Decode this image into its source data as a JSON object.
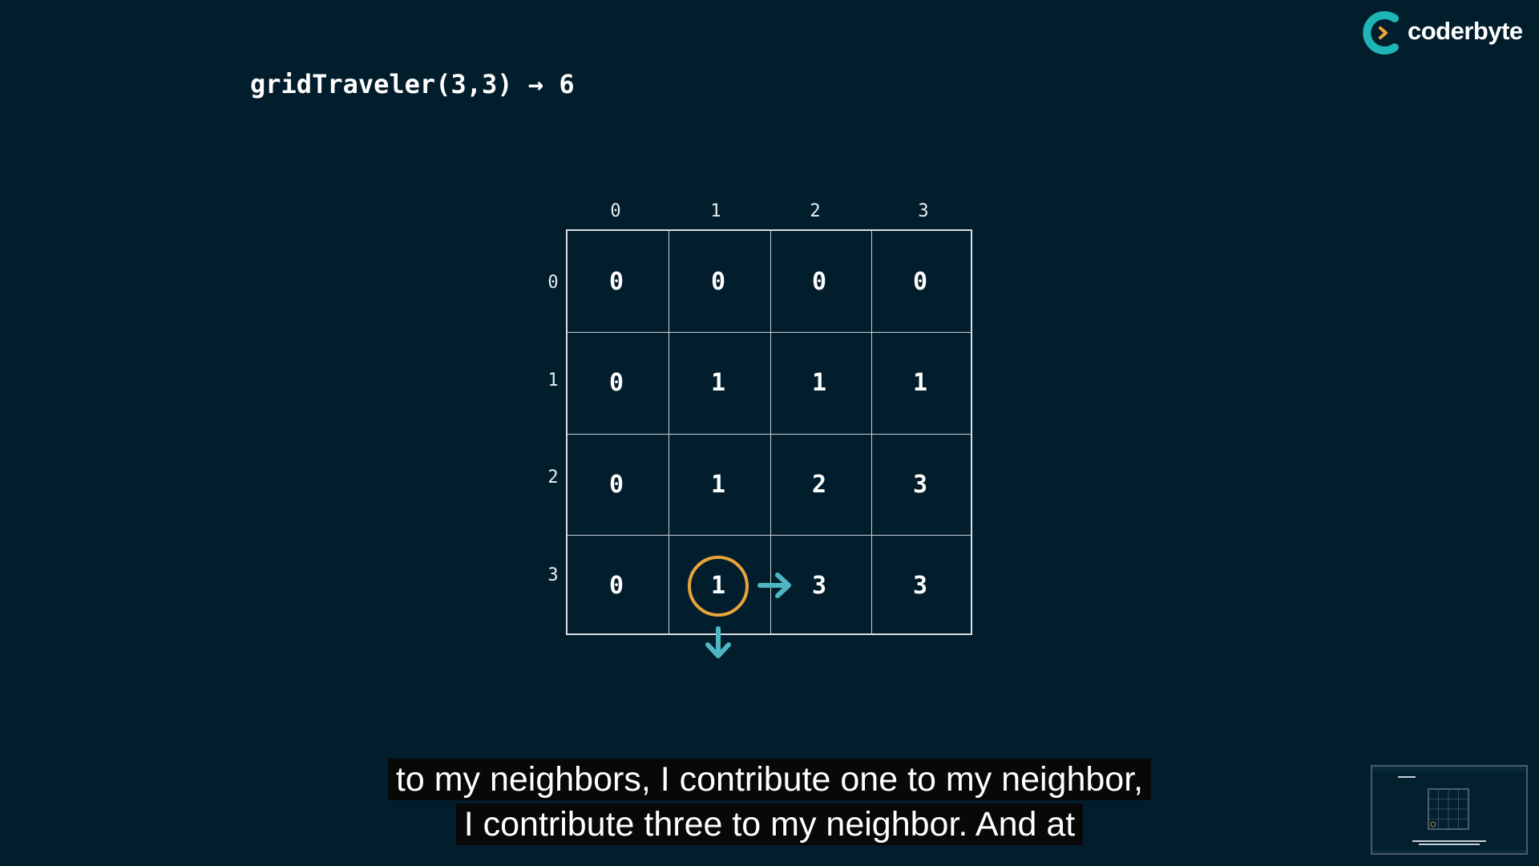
{
  "header": {
    "title": "gridTraveler(3,3) → 6"
  },
  "brand": {
    "name": "coderbyte",
    "logo_colors": {
      "ring": "#1fb5b5",
      "chevron": "#f2a33a"
    }
  },
  "grid": {
    "column_labels": [
      "0",
      "1",
      "2",
      "3"
    ],
    "row_labels": [
      "0",
      "1",
      "2",
      "3"
    ],
    "rows": [
      [
        "0",
        "0",
        "0",
        "0"
      ],
      [
        "0",
        "1",
        "1",
        "1"
      ],
      [
        "0",
        "1",
        "2",
        "3"
      ],
      [
        "0",
        "1",
        "3",
        "3"
      ]
    ],
    "highlighted_cell": {
      "row": 3,
      "col": 1,
      "color": "#e9a43a"
    },
    "arrow_color": "#4fb7c4",
    "arrows": [
      "right",
      "down"
    ]
  },
  "subtitles": {
    "line1": "to my neighbors, I contribute one to my neighbor,",
    "line2": "I contribute three to my neighbor. And at"
  },
  "thumbnail": {
    "icon": "video-preview-thumbnail"
  }
}
